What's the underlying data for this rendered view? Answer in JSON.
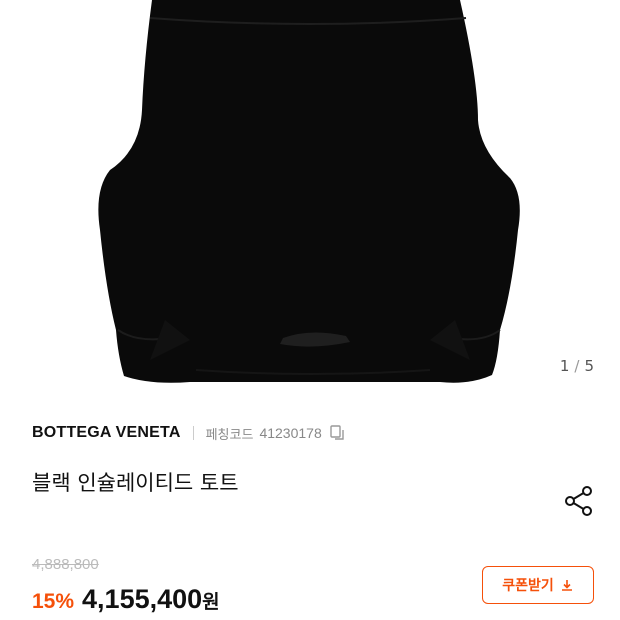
{
  "gallery": {
    "current": "1",
    "separator": "/",
    "total": "5"
  },
  "product": {
    "brand": "BOTTEGA VENETA",
    "code_label": "페칭코드",
    "code_value": "41230178",
    "title": "블랙 인슐레이티드 토트"
  },
  "pricing": {
    "original_price": "4,888,800",
    "discount": "15%",
    "price": "4,155,400",
    "currency": "원"
  },
  "coupon": {
    "label": "쿠폰받기"
  },
  "colors": {
    "accent": "#f5500a",
    "bag": "#0a0a0a"
  },
  "icons": [
    "product-image",
    "copy-icon",
    "share-icon",
    "download-icon"
  ]
}
